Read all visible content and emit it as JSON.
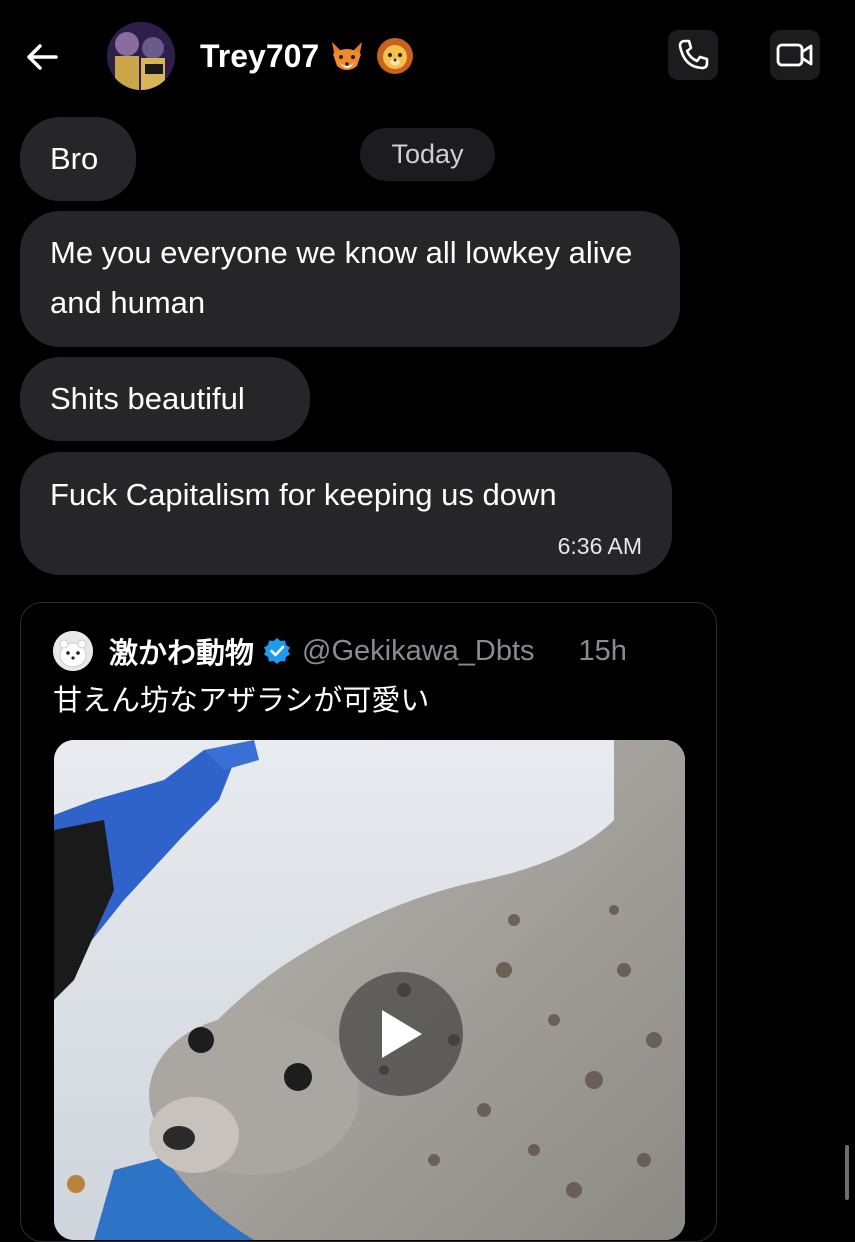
{
  "header": {
    "contact_name": "Trey707",
    "emoji_badges": [
      "fox-emoji",
      "lion-emoji"
    ],
    "icons": [
      "back-arrow-icon",
      "phone-icon",
      "video-camera-icon"
    ]
  },
  "date_separator": "Today",
  "messages": [
    {
      "text": "Bro"
    },
    {
      "text": "Me you everyone we know all lowkey alive and human"
    },
    {
      "text": "Shits beautiful"
    },
    {
      "text": "Fuck Capitalism for keeping us down",
      "time": "6:36 AM"
    }
  ],
  "shared_tweet": {
    "author": "激かわ動物",
    "handle": "@Gekikawa_Dbts",
    "age": "15h",
    "text": "甘えん坊なアザラシが可愛い",
    "verified": true,
    "media": {
      "type": "video",
      "subject": "seal",
      "icon": "play-icon"
    }
  },
  "colors": {
    "background": "#000000",
    "bubble": "#262628",
    "chip": "#1c1c1e",
    "secondary_text": "#8b8b8f",
    "verified_badge": "#1d9bf0"
  }
}
